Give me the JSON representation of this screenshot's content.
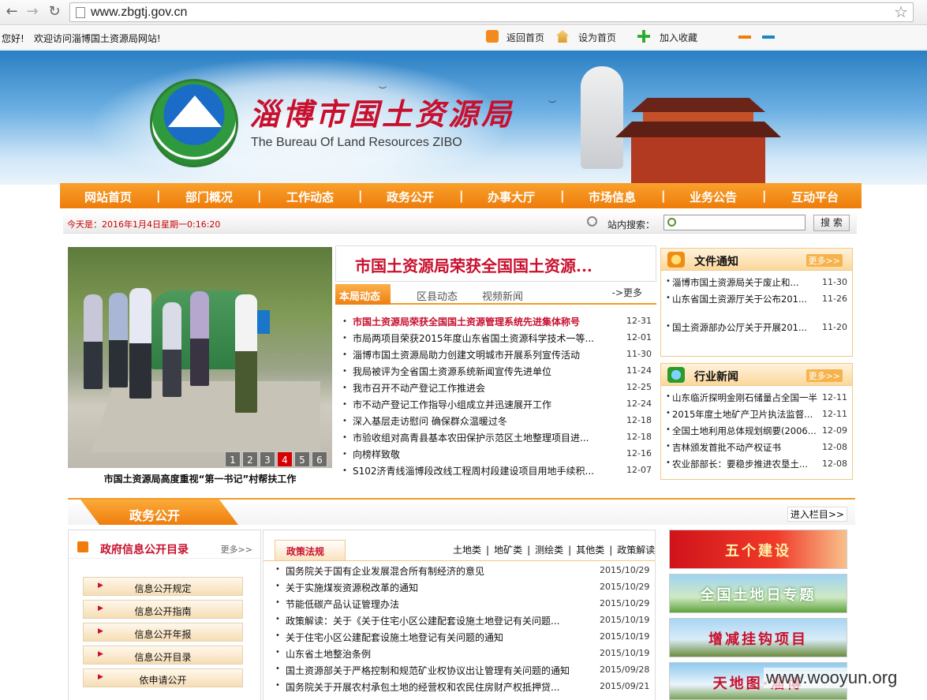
{
  "browser": {
    "back": "←",
    "forward": "→",
    "reload": "↻",
    "url": "www.zbgtj.gov.cn",
    "star": "☆"
  },
  "topbar": {
    "hello": "您好!",
    "welcome": "欢迎访问淄博国土资源局网站!",
    "links": [
      "返回首页",
      "设为首页",
      "加入收藏"
    ]
  },
  "banner": {
    "title": "淄博市国土资源局",
    "subtitle": "The Bureau Of Land Resources ZIBO"
  },
  "nav": [
    "网站首页",
    "部门概况",
    "工作动态",
    "政务公开",
    "办事大厅",
    "市场信息",
    "业务公告",
    "互动平台"
  ],
  "datebar": {
    "today": "今天是：2016年1月4日星期一0:16:20",
    "search_label": "站内搜索：",
    "search_value": "",
    "search_button": "搜 索"
  },
  "slideshow": {
    "pages": [
      "1",
      "2",
      "3",
      "4",
      "5",
      "6"
    ],
    "active_page": "4",
    "caption": "市国土资源局高度重视“第一书记”村帮扶工作"
  },
  "headline": "市国土资源局荣获全国国土资源...",
  "news": {
    "tabs": [
      "本局动态",
      "区县动态",
      "视频新闻"
    ],
    "more": "->更多",
    "items": [
      {
        "title": "市国土资源局荣获全国国土资源管理系统先进集体称号",
        "date": "12-31"
      },
      {
        "title": "市局两项目荣获2015年度山东省国土资源科学技术一等...",
        "date": "12-01"
      },
      {
        "title": "淄博市国土资源局助力创建文明城市开展系列宣传活动",
        "date": "11-30"
      },
      {
        "title": "我局被评为全省国土资源系统新闻宣传先进单位",
        "date": "11-24"
      },
      {
        "title": "我市召开不动产登记工作推进会",
        "date": "12-25"
      },
      {
        "title": "市不动产登记工作指导小组成立并迅速展开工作",
        "date": "12-24"
      },
      {
        "title": "深入基层走访慰问 确保群众温暖过冬",
        "date": "12-18"
      },
      {
        "title": "市验收组对高青县基本农田保护示范区土地整理项目进...",
        "date": "12-18"
      },
      {
        "title": "向榜样致敬",
        "date": "12-16"
      },
      {
        "title": "S102济青线淄博段改线工程周村段建设项目用地手续积...",
        "date": "12-07"
      }
    ]
  },
  "notices": {
    "title": "文件通知",
    "more": "更多>>",
    "items": [
      {
        "title": "淄博市国土资源局关于废止和...",
        "date": "11-30"
      },
      {
        "title": "山东省国土资源厅关于公布201...",
        "date": "11-26"
      },
      {
        "title": "国土资源部办公厅关于开展201...",
        "date": "11-20"
      }
    ]
  },
  "industry": {
    "title": "行业新闻",
    "more": "更多>>",
    "items": [
      {
        "title": "山东临沂探明金刚石储量占全国一半",
        "date": "12-11"
      },
      {
        "title": "2015年度土地矿产卫片执法监督...",
        "date": "12-11"
      },
      {
        "title": "全国土地利用总体规划纲要(2006...",
        "date": "12-09"
      },
      {
        "title": "吉林颁发首批不动产权证书",
        "date": "12-08"
      },
      {
        "title": "农业部部长：要稳步推进农垦土...",
        "date": "12-08"
      }
    ]
  },
  "section": {
    "title": "政务公开",
    "enter": "进入栏目>>"
  },
  "disclosure": {
    "title": "政府信息公开目录",
    "more": "更多>>",
    "buttons": [
      "信息公开规定",
      "信息公开指南",
      "信息公开年报",
      "信息公开目录",
      "依申请公开"
    ]
  },
  "policy": {
    "tab": "政策法规",
    "cats": [
      "土地类",
      "地矿类",
      "测绘类",
      "其他类",
      "政策解读"
    ],
    "items": [
      {
        "title": "国务院关于国有企业发展混合所有制经济的意见",
        "date": "2015/10/29"
      },
      {
        "title": "关于实施煤炭资源税改革的通知",
        "date": "2015/10/29"
      },
      {
        "title": "节能低碳产品认证管理办法",
        "date": "2015/10/29"
      },
      {
        "title": "政策解读：关于《关于住宅小区公建配套设施土地登记有关问题...",
        "date": "2015/10/19"
      },
      {
        "title": "关于住宅小区公建配套设施土地登记有关问题的通知",
        "date": "2015/10/19"
      },
      {
        "title": "山东省土地整治条例",
        "date": "2015/10/19"
      },
      {
        "title": "国土资源部关于严格控制和规范矿业权协议出让管理有关问题的通知",
        "date": "2015/09/28"
      },
      {
        "title": "国务院关于开展农村承包土地的经营权和农民住房财产权抵押贷...",
        "date": "2015/09/21"
      }
    ]
  },
  "promos": [
    "五个建设",
    "全国土地日专题",
    "增减挂钩项目",
    "天地图·淄博"
  ],
  "watermark": "www.wooyun.org",
  "colors": {
    "accent": "#ee7c0a",
    "headline_red": "#c8102e",
    "active_page": "#d60000"
  }
}
